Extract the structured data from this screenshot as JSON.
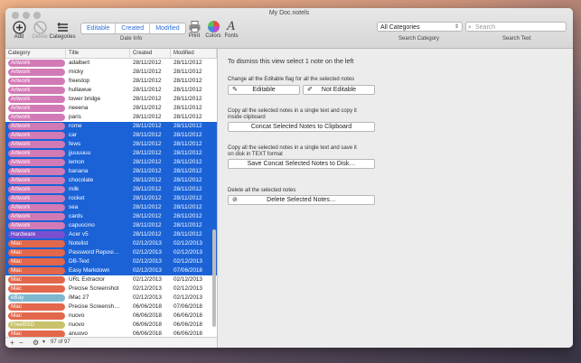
{
  "window": {
    "title": "My Doc.notels"
  },
  "toolbar": {
    "add": "Add",
    "delete": "Delete",
    "categories": "Categories",
    "tabs": [
      "Editable",
      "Created",
      "Modified"
    ],
    "date_info": "Date Info",
    "print": "Print",
    "colors": "Colors",
    "fonts": "Fonts",
    "category_select": "All Categories",
    "search_placeholder": "Search",
    "search_category_label": "Search Category",
    "search_text_label": "Search Text"
  },
  "table": {
    "headers": [
      "Category",
      "Title",
      "Created",
      "Modified"
    ],
    "rows": [
      {
        "cat": "Artwork",
        "color": "#d27ab6",
        "title": "adalbert",
        "created": "28/11/2012",
        "modified": "28/11/2012",
        "sel": false
      },
      {
        "cat": "Artwork",
        "color": "#d27ab6",
        "title": "micky",
        "created": "28/11/2012",
        "modified": "28/11/2012",
        "sel": false
      },
      {
        "cat": "Artwork",
        "color": "#d27ab6",
        "title": "freestop",
        "created": "28/11/2012",
        "modified": "28/11/2012",
        "sel": false
      },
      {
        "cat": "Artwork",
        "color": "#d27ab6",
        "title": "hullawue",
        "created": "28/11/2012",
        "modified": "28/11/2012",
        "sel": false
      },
      {
        "cat": "Artwork",
        "color": "#d27ab6",
        "title": "tower bridge",
        "created": "28/11/2012",
        "modified": "28/11/2012",
        "sel": false
      },
      {
        "cat": "Artwork",
        "color": "#d27ab6",
        "title": "neeena",
        "created": "28/11/2012",
        "modified": "28/11/2012",
        "sel": false
      },
      {
        "cat": "Artwork",
        "color": "#d27ab6",
        "title": "paris",
        "created": "28/11/2012",
        "modified": "28/11/2012",
        "sel": false
      },
      {
        "cat": "Artwork",
        "color": "#d27ab6",
        "title": "rome",
        "created": "28/11/2012",
        "modified": "28/11/2012",
        "sel": true
      },
      {
        "cat": "Artwork",
        "color": "#d27ab6",
        "title": "car",
        "created": "28/11/2012",
        "modified": "28/11/2012",
        "sel": true
      },
      {
        "cat": "Artwork",
        "color": "#d27ab6",
        "title": "fews",
        "created": "28/11/2012",
        "modified": "28/11/2012",
        "sel": true
      },
      {
        "cat": "Artwork",
        "color": "#d27ab6",
        "title": "jjuuuuuu",
        "created": "28/11/2012",
        "modified": "28/11/2012",
        "sel": true
      },
      {
        "cat": "Artwork",
        "color": "#d27ab6",
        "title": "lemon",
        "created": "28/11/2012",
        "modified": "28/11/2012",
        "sel": true
      },
      {
        "cat": "Artwork",
        "color": "#d27ab6",
        "title": "banana",
        "created": "28/11/2012",
        "modified": "28/11/2012",
        "sel": true
      },
      {
        "cat": "Artwork",
        "color": "#d27ab6",
        "title": "chocolate",
        "created": "28/11/2012",
        "modified": "28/11/2012",
        "sel": true
      },
      {
        "cat": "Artwork",
        "color": "#d27ab6",
        "title": "milk",
        "created": "28/11/2012",
        "modified": "28/11/2012",
        "sel": true
      },
      {
        "cat": "Artwork",
        "color": "#d27ab6",
        "title": "rocket",
        "created": "28/11/2012",
        "modified": "28/11/2012",
        "sel": true
      },
      {
        "cat": "Artwork",
        "color": "#d27ab6",
        "title": "sea",
        "created": "28/11/2012",
        "modified": "28/11/2012",
        "sel": true
      },
      {
        "cat": "Artwork",
        "color": "#d27ab6",
        "title": "cards",
        "created": "28/11/2012",
        "modified": "28/11/2012",
        "sel": true
      },
      {
        "cat": "Artwork",
        "color": "#d27ab6",
        "title": "capuccino",
        "created": "28/11/2012",
        "modified": "28/11/2012",
        "sel": true
      },
      {
        "cat": "Hardware",
        "color": "#7a4fcf",
        "title": "Acer v5",
        "created": "28/11/2012",
        "modified": "28/11/2012",
        "sel": true
      },
      {
        "cat": "Mac",
        "color": "#e2674b",
        "title": "Notelist",
        "created": "02/12/2013",
        "modified": "02/12/2013",
        "sel": true
      },
      {
        "cat": "Mac",
        "color": "#e2674b",
        "title": "Password Reposi…",
        "created": "02/12/2013",
        "modified": "02/12/2013",
        "sel": true
      },
      {
        "cat": "Mac",
        "color": "#e2674b",
        "title": "DB-Text",
        "created": "02/12/2013",
        "modified": "02/12/2013",
        "sel": true
      },
      {
        "cat": "Mac",
        "color": "#e2674b",
        "title": "Easy Markdown",
        "created": "02/12/2013",
        "modified": "07/06/2018",
        "sel": true
      },
      {
        "cat": "Mac",
        "color": "#e2674b",
        "title": "URL Extractor",
        "created": "02/12/2013",
        "modified": "02/12/2013",
        "sel": false
      },
      {
        "cat": "Mac",
        "color": "#e2674b",
        "title": "Precise Screenshot",
        "created": "02/12/2013",
        "modified": "02/12/2013",
        "sel": false
      },
      {
        "cat": "eBay",
        "color": "#7fb7cf",
        "title": "iMac 27",
        "created": "02/12/2013",
        "modified": "02/12/2013",
        "sel": false
      },
      {
        "cat": "Mac",
        "color": "#e2674b",
        "title": "Precise Screensh…",
        "created": "06/06/2018",
        "modified": "07/06/2018",
        "sel": false
      },
      {
        "cat": "Mac",
        "color": "#e2674b",
        "title": "nuovo",
        "created": "06/06/2018",
        "modified": "06/06/2018",
        "sel": false
      },
      {
        "cat": "FreeBSD",
        "color": "#c8c26a",
        "title": "nuovo",
        "created": "06/06/2018",
        "modified": "06/06/2018",
        "sel": false
      },
      {
        "cat": "Mac",
        "color": "#e2674b",
        "title": "anuovo",
        "created": "06/06/2018",
        "modified": "06/06/2018",
        "sel": false
      }
    ]
  },
  "footer": {
    "plus": "+",
    "minus": "−",
    "gear": "⚙",
    "count": "97 of 97"
  },
  "panel": {
    "dismiss_text": "To dismiss this view select 1 note on the left",
    "editable_desc": "Change all the Editable flag for all the selected notes",
    "btn_editable": "Editable",
    "btn_not_editable": "Not Editable",
    "concat_desc": "Copy all the selected notes in a single text and copy it inside clipboard",
    "btn_concat_clip": "Concat Selected Notes to Clipboard",
    "save_desc": "Copy all the selected notes in a single text and save it on disk in TEXT format",
    "btn_save_disk": "Save Concat Selected Notes to Disk…",
    "delete_desc": "Delete all the selected notes",
    "btn_delete": "Delete Selected Notes…"
  }
}
